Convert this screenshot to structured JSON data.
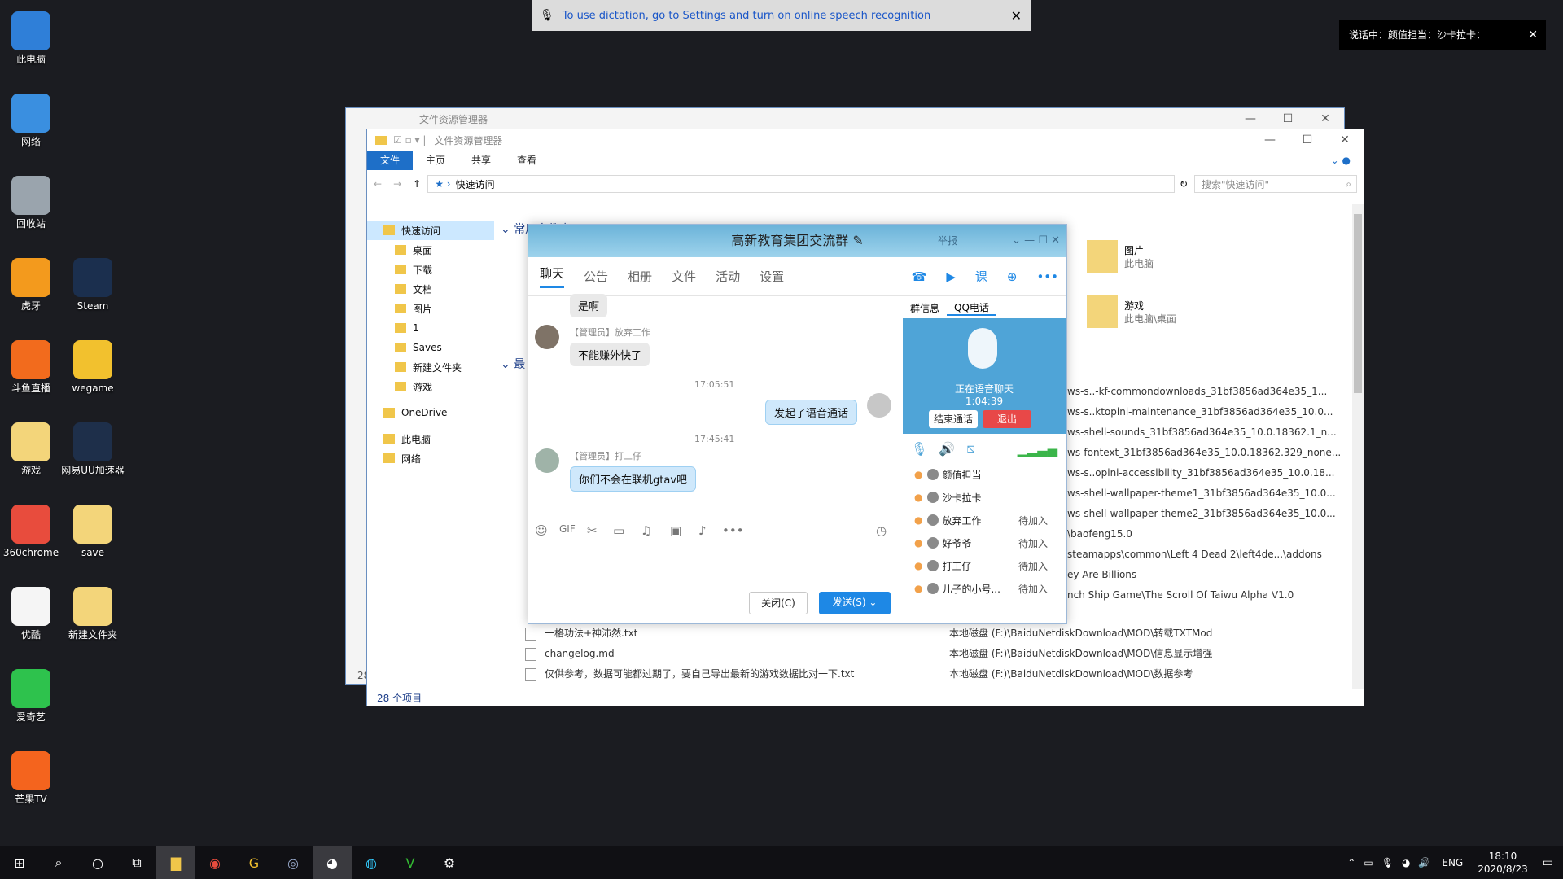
{
  "desktop": [
    {
      "label": "此电脑",
      "icon": "computer-icon",
      "color": "#2f7fd8"
    },
    {
      "label": "网络",
      "icon": "network-icon",
      "color": "#3a8fe0"
    },
    {
      "label": "回收站",
      "icon": "recycle-bin-icon",
      "color": "#9aa4ad"
    },
    {
      "label": "虎牙",
      "icon": "huya-icon",
      "color": "#f39a1d"
    },
    {
      "label": "Steam",
      "icon": "steam-icon",
      "color": "#1b2f4e"
    },
    {
      "label": "斗鱼直播",
      "icon": "douyu-icon",
      "color": "#f26b1d"
    },
    {
      "label": "wegame",
      "icon": "wegame-icon",
      "color": "#f2c12e"
    },
    {
      "label": "游戏",
      "icon": "folder-icon",
      "color": "#f3d57a"
    },
    {
      "label": "网易UU加速器",
      "icon": "uu-icon",
      "color": "#1e2f4a"
    },
    {
      "label": "360chrome",
      "icon": "chrome360-icon",
      "color": "#e84c3d"
    },
    {
      "label": "save",
      "icon": "folder-icon",
      "color": "#f3d57a"
    },
    {
      "label": "优酷",
      "icon": "youku-icon",
      "color": "#f5f5f5"
    },
    {
      "label": "新建文件夹",
      "icon": "folder-icon",
      "color": "#f3d57a"
    },
    {
      "label": "爱奇艺",
      "icon": "iqiyi-icon",
      "color": "#2ec24d"
    },
    {
      "label": "芒果TV",
      "icon": "mangotv-icon",
      "color": "#f4641e"
    }
  ],
  "dictation": {
    "text": "To use dictation, go to Settings and turn on online speech recognition"
  },
  "toast": {
    "text": "说话中：颜值担当：沙卡拉卡："
  },
  "explorer_back": {
    "title": "文件资源管理器",
    "status": "28"
  },
  "explorer": {
    "title": "文件资源管理器",
    "ribbon": [
      "文件",
      "主页",
      "共享",
      "查看"
    ],
    "address": "快速访问",
    "search_placeholder": "搜索\"快速访问\"",
    "nav": [
      "快速访问",
      "桌面",
      "下载",
      "文档",
      "图片",
      "1",
      "Saves",
      "新建文件夹",
      "游戏",
      "OneDrive",
      "此电脑",
      "网络"
    ],
    "section1": "常用文件夹 (8)",
    "section2": "最",
    "pinned": [
      {
        "name": "图片",
        "sub": "此电脑"
      },
      {
        "name": "游戏",
        "sub": "此电脑\\桌面"
      }
    ],
    "recent_right": [
      "ws-s..-kf-commondownloads_31bf3856ad364e35_1...",
      "ws-s..ktopini-maintenance_31bf3856ad364e35_10.0...",
      "ws-shell-sounds_31bf3856ad364e35_10.0.18362.1_n...",
      "ws-fontext_31bf3856ad364e35_10.0.18362.329_none...",
      "ws-s..opini-accessibility_31bf3856ad364e35_10.0.18...",
      "ws-shell-wallpaper-theme1_31bf3856ad364e35_10.0...",
      "ws-shell-wallpaper-theme2_31bf3856ad364e35_10.0...",
      "\\baofeng15.0",
      "steamapps\\common\\Left 4 Dead 2\\left4de...\\addons",
      "ey Are Billions",
      "nch Ship Game\\The Scroll Of Taiwu Alpha V1.0"
    ],
    "files": [
      {
        "name": "一格功法+神沛然.txt",
        "path": "本地磁盘 (F:)\\BaiduNetdiskDownload\\MOD\\转载TXTMod"
      },
      {
        "name": "changelog.md",
        "path": "本地磁盘 (F:)\\BaiduNetdiskDownload\\MOD\\信息显示增强"
      },
      {
        "name": "仅供参考，数据可能都过期了，要自己导出最新的游戏数据比对一下.txt",
        "path": "本地磁盘 (F:)\\BaiduNetdiskDownload\\MOD\\数据参考"
      }
    ],
    "status": "28 个项目"
  },
  "qq": {
    "title": "高新教育集团交流群",
    "report": "举报",
    "tabs": [
      "聊天",
      "公告",
      "相册",
      "文件",
      "活动",
      "设置"
    ],
    "messages": {
      "m0": "是啊",
      "nick1": "【管理员】放弃工作",
      "m1": "不能赚外快了",
      "t1": "17:05:51",
      "m2": "发起了语音通话",
      "t2": "17:45:41",
      "nick3": "【管理员】打工仔",
      "m3": "你们不会在联机gtav吧"
    },
    "close_btn": "关闭(C)",
    "send_btn": "发送(S)",
    "side_tabs": [
      "群信息",
      "QQ电话"
    ],
    "voice_status": "正在语音聊天",
    "voice_time": "1:04:39",
    "end_call": "结束通话",
    "quit": "退出",
    "members": [
      {
        "name": "颜值担当",
        "status": ""
      },
      {
        "name": "沙卡拉卡",
        "status": ""
      },
      {
        "name": "放弃工作",
        "status": "待加入"
      },
      {
        "name": "好爷爷",
        "status": "待加入"
      },
      {
        "name": "打工仔",
        "status": "待加入"
      },
      {
        "name": "儿子的小号...",
        "status": "待加入"
      }
    ]
  },
  "tray": {
    "lang": "ENG",
    "time": "18:10",
    "date": "2020/8/23"
  }
}
